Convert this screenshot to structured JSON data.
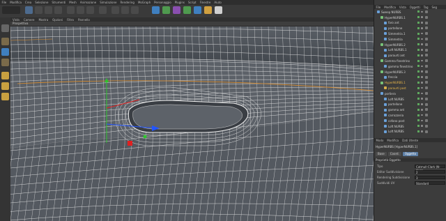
{
  "menubar": {
    "items": [
      "File",
      "Modifica",
      "Crea",
      "Selezione",
      "Strumenti",
      "Mesh",
      "Animazione",
      "Simulazione",
      "Rendering",
      "MoGraph",
      "Personaggio",
      "Plugins",
      "Script",
      "Finestre",
      "Aiuto"
    ]
  },
  "viewport": {
    "menu": [
      "Vista",
      "Camere",
      "Mostra",
      "Opzioni",
      "Filtro",
      "Pannello"
    ],
    "title": "Prospettiva"
  },
  "object_manager": {
    "menu": [
      "File",
      "Modifica",
      "Vista",
      "Oggetti",
      "Tag",
      "Seg"
    ],
    "rows": [
      {
        "label": "Sweep NURBS",
        "indent": 0,
        "icon": "#6aa0d8",
        "active": false
      },
      {
        "label": "HyperNURBS.1",
        "indent": 1,
        "icon": "#78c278",
        "active": false
      },
      {
        "label": "faro ant",
        "indent": 2,
        "icon": "#6aa0d8",
        "active": false
      },
      {
        "label": "portellone",
        "indent": 2,
        "icon": "#6aa0d8",
        "active": false
      },
      {
        "label": "Simmetria.1",
        "indent": 2,
        "icon": "#6aa0d8",
        "active": false
      },
      {
        "label": "Simmetria",
        "indent": 2,
        "icon": "#6aa0d8",
        "active": false
      },
      {
        "label": "HyperNURBS.2",
        "indent": 1,
        "icon": "#78c278",
        "active": false
      },
      {
        "label": "Loft NURBS.1",
        "indent": 2,
        "icon": "#6aa0d8",
        "active": false
      },
      {
        "label": "paraurti ant",
        "indent": 2,
        "icon": "#6aa0d8",
        "active": false
      },
      {
        "label": "Gomma finestrino",
        "indent": 1,
        "icon": "#78c278",
        "active": false
      },
      {
        "label": "gomma finestrino",
        "indent": 2,
        "icon": "#6aa0d8",
        "active": false
      },
      {
        "label": "HyperNURBS.3",
        "indent": 1,
        "icon": "#78c278",
        "active": false
      },
      {
        "label": "freccia",
        "indent": 2,
        "icon": "#6aa0d8",
        "active": false
      },
      {
        "label": "HyperNURBS.1",
        "indent": 1,
        "icon": "#78c278",
        "active": true
      },
      {
        "label": "paraurti post",
        "indent": 2,
        "icon": "#d8b04a",
        "active": true
      },
      {
        "label": "portiera",
        "indent": 1,
        "icon": "#6aa0d8",
        "active": false
      },
      {
        "label": "Loft NURBS",
        "indent": 2,
        "icon": "#6aa0d8",
        "active": false
      },
      {
        "label": "portellone",
        "indent": 2,
        "icon": "#6aa0d8",
        "active": false
      },
      {
        "label": "gomma ant",
        "indent": 2,
        "icon": "#6aa0d8",
        "active": false
      },
      {
        "label": "carrozzeria",
        "indent": 2,
        "icon": "#6aa0d8",
        "active": false
      },
      {
        "label": "cofano post",
        "indent": 2,
        "icon": "#6aa0d8",
        "active": false
      },
      {
        "label": "Loft NURBS",
        "indent": 2,
        "icon": "#6aa0d8",
        "active": false
      },
      {
        "label": "Loft NURBS",
        "indent": 2,
        "icon": "#6aa0d8",
        "active": false
      }
    ]
  },
  "attribute_manager": {
    "menu": [
      "Modo",
      "Modifica",
      "Dati Utente"
    ],
    "header": "HyperNURBS [HyperNURBS.1]",
    "tabs": [
      "Base",
      "Coord.",
      "Oggetto"
    ],
    "active_tab": "Oggetto",
    "section": "Proprietà Oggetto",
    "props": [
      {
        "label": "Tipo",
        "value": "Catmull-Clark (N-Ango"
      },
      {
        "label": "Editor Suddivisione",
        "value": "2"
      },
      {
        "label": "Rendering Suddivisione",
        "value": "3"
      },
      {
        "label": "Suddividi UV",
        "value": "Standard"
      }
    ]
  },
  "colors": {
    "accent": "#5d7fa6",
    "wire": "#e8e8e8",
    "selection_orange": "#d88a2a",
    "axis_green": "#2ec42e",
    "axis_red": "#e02020",
    "axis_blue": "#2255ff"
  }
}
